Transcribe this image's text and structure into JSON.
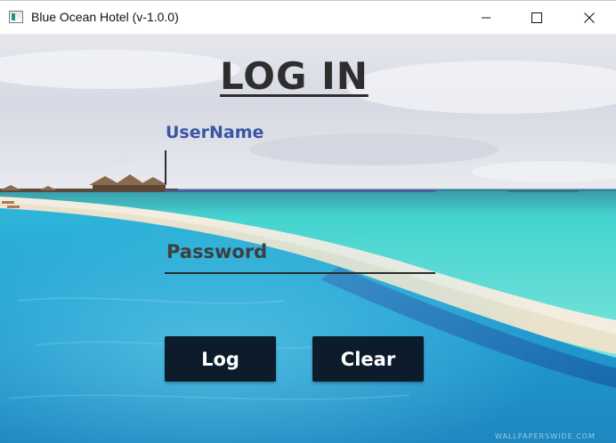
{
  "window": {
    "title": "Blue Ocean Hotel (v-1.0.0)",
    "icon": "app-window-icon",
    "controls": [
      "minimize-icon",
      "maximize-icon",
      "close-icon"
    ]
  },
  "login": {
    "heading": "LOG IN",
    "username_label": "UserName",
    "username_value": "",
    "password_placeholder": "Password",
    "password_value": "",
    "log_button": "Log",
    "clear_button": "Clear"
  },
  "background": {
    "scene": "tropical beach with overwater villas and turquoise infinity pool",
    "watermark": "WALLPAPERSWIDE.COM"
  },
  "colors": {
    "heading": "#2e2e2e",
    "username_label": "#3b55a3",
    "button_bg": "#0d1c2b",
    "button_text": "#ffffff",
    "sea": "#3fc9cf",
    "pool": "#1f8fc4"
  }
}
